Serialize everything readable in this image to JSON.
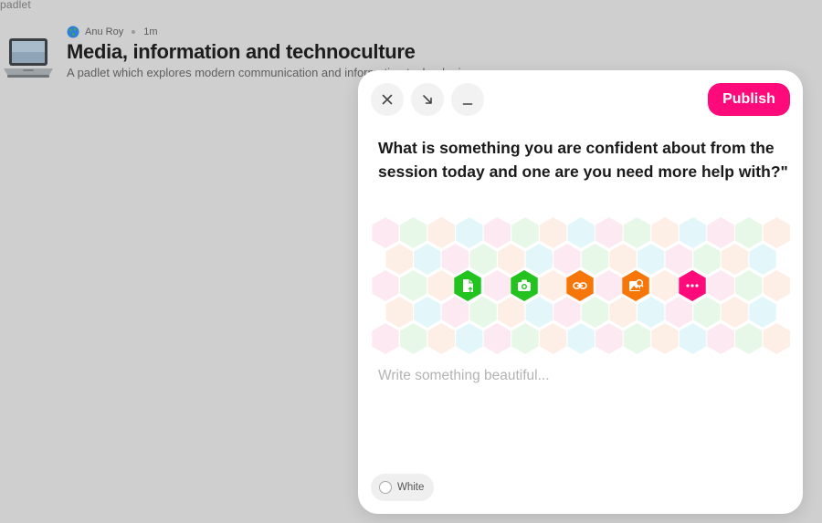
{
  "brand": {
    "name": "padlet"
  },
  "board": {
    "author": "Anu Roy",
    "time": "1m",
    "title": "Media, information and technoculture",
    "description": "A padlet which explores modern communication and information technologies"
  },
  "composer": {
    "publish_label": "Publish",
    "prompt": "What is something you are confident about from the session today and one are you need more help with?\"",
    "body_placeholder": "Write something beautiful...",
    "color_label": "White",
    "attachment_actions": [
      {
        "name": "upload-file",
        "color": "#22c21f",
        "icon": "file-upload-icon"
      },
      {
        "name": "camera",
        "color": "#22c21f",
        "icon": "camera-icon"
      },
      {
        "name": "link",
        "color": "#f7760a",
        "icon": "link-icon"
      },
      {
        "name": "image-search",
        "color": "#f7760a",
        "icon": "image-search-icon"
      },
      {
        "name": "more",
        "color": "#ff0a7a",
        "icon": "more-icon"
      }
    ],
    "colors": {
      "accent": "#ff0a7a",
      "green": "#22c21f",
      "orange": "#f7760a",
      "pastels": [
        "#fde9f1",
        "#e8f8e8",
        "#fdeee6",
        "#e3f7fb"
      ]
    }
  }
}
